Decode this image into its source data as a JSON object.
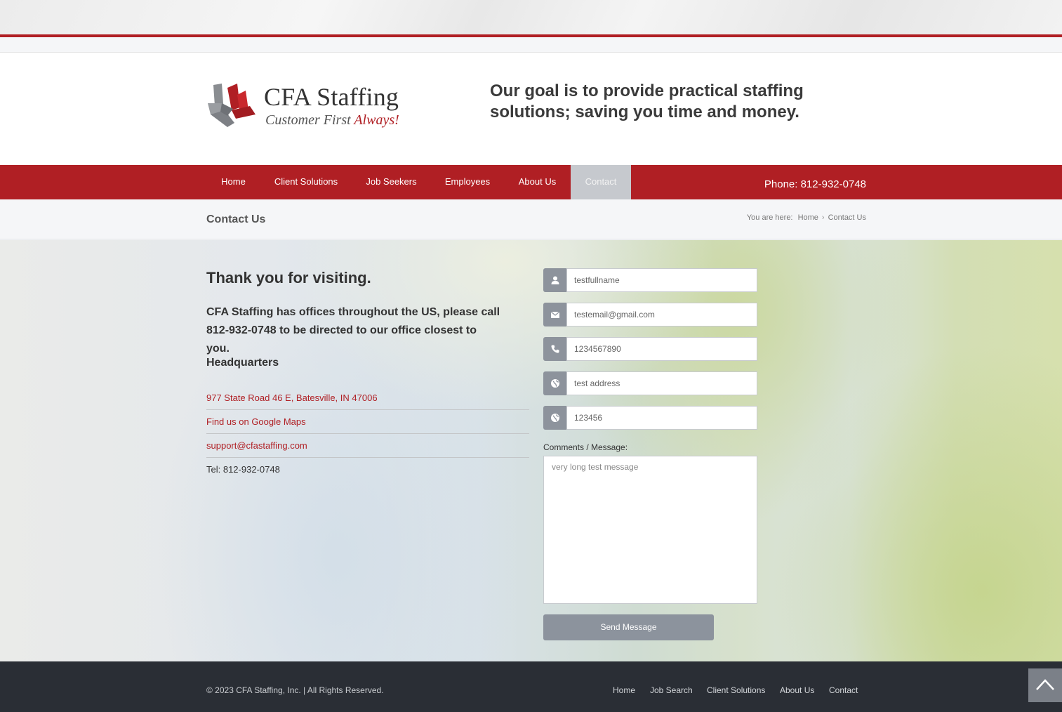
{
  "brand": {
    "name": "CFA Staffing",
    "tagline_prefix": "Customer First",
    "tagline_emphasis": "Always!",
    "goal": "Our goal is to provide practical staffing solutions; saving you time and money."
  },
  "nav": {
    "items": [
      {
        "label": "Home"
      },
      {
        "label": "Client Solutions"
      },
      {
        "label": "Job Seekers"
      },
      {
        "label": "Employees"
      },
      {
        "label": "About Us"
      },
      {
        "label": "Contact",
        "active": true
      }
    ],
    "phone": "Phone: 812-932-0748"
  },
  "titlebar": {
    "title": "Contact Us",
    "breadcrumb_prefix": "You are here:",
    "breadcrumb": [
      "Home",
      "Contact Us"
    ]
  },
  "contact_info": {
    "heading": "Thank you for visiting.",
    "intro": "CFA Staffing has offices throughout the US, please call 812-932-0748 to be directed to our office closest to you.",
    "hq_heading": "Headquarters",
    "address": "977 State Road 46 E, Batesville, IN 47006",
    "maps_link": "Find us on Google Maps",
    "email": "support@cfastaffing.com",
    "tel": "Tel: 812-932-0748"
  },
  "form": {
    "fullname": "testfullname",
    "email": "testemail@gmail.com",
    "phone": "1234567890",
    "address": "test address",
    "zip": "123456",
    "message_label": "Comments / Message:",
    "message": "very long test message",
    "submit_label": "Send Message",
    "icons": [
      "user-icon",
      "envelope-icon",
      "phone-icon",
      "globe-icon",
      "globe-icon"
    ]
  },
  "footer": {
    "copyright": "© 2023 CFA Staffing, Inc. | All Rights Reserved.",
    "links": [
      "Home",
      "Job Search",
      "Client Solutions",
      "About Us",
      "Contact"
    ]
  },
  "colors": {
    "brand_red": "#b01f24",
    "footer_bg": "#2a2e35",
    "button_gray": "#8c939d"
  }
}
